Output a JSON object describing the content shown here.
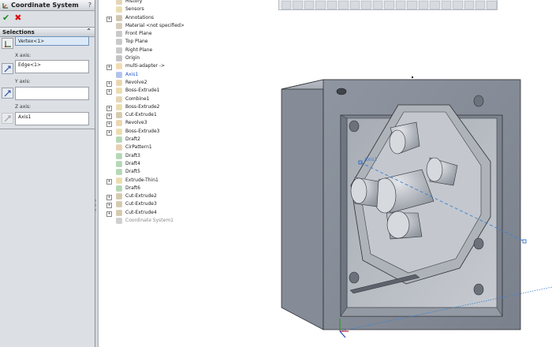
{
  "property_manager": {
    "title": "Coordinate System",
    "help": "?",
    "selections_header": "Selections",
    "origin_value": "Vertex<1>",
    "x_axis_label": "X axis:",
    "x_axis_value": "Edge<1>",
    "y_axis_label": "Y axis:",
    "y_axis_value": "",
    "z_axis_label": "Z axis:",
    "z_axis_value": "Axis1"
  },
  "tree": {
    "items": [
      {
        "label": "History",
        "icon": "history-icon",
        "expand": "",
        "style": ""
      },
      {
        "label": "Sensors",
        "icon": "sensor-icon",
        "expand": "",
        "style": ""
      },
      {
        "label": "Annotations",
        "icon": "annotation-icon",
        "expand": "+",
        "style": ""
      },
      {
        "label": "Material <not specified>",
        "icon": "material-icon",
        "expand": "",
        "style": ""
      },
      {
        "label": "Front Plane",
        "icon": "plane-icon",
        "expand": "",
        "style": ""
      },
      {
        "label": "Top Plane",
        "icon": "plane-icon",
        "expand": "",
        "style": ""
      },
      {
        "label": "Right Plane",
        "icon": "plane-icon",
        "expand": "",
        "style": ""
      },
      {
        "label": "Origin",
        "icon": "origin-icon",
        "expand": "",
        "style": ""
      },
      {
        "label": "multi-adapter ->",
        "icon": "part-icon",
        "expand": "+",
        "style": ""
      },
      {
        "label": "Axis1",
        "icon": "axis-icon",
        "expand": "",
        "style": "axis"
      },
      {
        "label": "Revolve2",
        "icon": "revolve-icon",
        "expand": "+",
        "style": ""
      },
      {
        "label": "Boss-Extrude1",
        "icon": "extrude-icon",
        "expand": "+",
        "style": ""
      },
      {
        "label": "Combine1",
        "icon": "combine-icon",
        "expand": "",
        "style": ""
      },
      {
        "label": "Boss-Extrude2",
        "icon": "extrude-icon",
        "expand": "+",
        "style": ""
      },
      {
        "label": "Cut-Extrude1",
        "icon": "cut-extrude-icon",
        "expand": "+",
        "style": ""
      },
      {
        "label": "Revolve3",
        "icon": "revolve-icon",
        "expand": "+",
        "style": ""
      },
      {
        "label": "Boss-Extrude3",
        "icon": "extrude-icon",
        "expand": "+",
        "style": ""
      },
      {
        "label": "Draft2",
        "icon": "draft-icon",
        "expand": "",
        "style": ""
      },
      {
        "label": "CirPattern1",
        "icon": "pattern-icon",
        "expand": "",
        "style": ""
      },
      {
        "label": "Draft3",
        "icon": "draft-icon",
        "expand": "",
        "style": ""
      },
      {
        "label": "Draft4",
        "icon": "draft-icon",
        "expand": "",
        "style": ""
      },
      {
        "label": "Draft5",
        "icon": "draft-icon",
        "expand": "",
        "style": ""
      },
      {
        "label": "Extrude-Thin1",
        "icon": "extrude-icon",
        "expand": "+",
        "style": ""
      },
      {
        "label": "Draft6",
        "icon": "draft-icon",
        "expand": "",
        "style": ""
      },
      {
        "label": "Cut-Extrude2",
        "icon": "cut-extrude-icon",
        "expand": "+",
        "style": ""
      },
      {
        "label": "Cut-Extrude3",
        "icon": "cut-extrude-icon",
        "expand": "+",
        "style": ""
      },
      {
        "label": "Cut-Extrude4",
        "icon": "cut-extrude-icon",
        "expand": "+",
        "style": ""
      },
      {
        "label": "Coordinate System1",
        "icon": "coordinate-system-icon",
        "expand": "",
        "style": "gray"
      }
    ]
  },
  "viewport": {
    "axis_label": "Axis1"
  }
}
